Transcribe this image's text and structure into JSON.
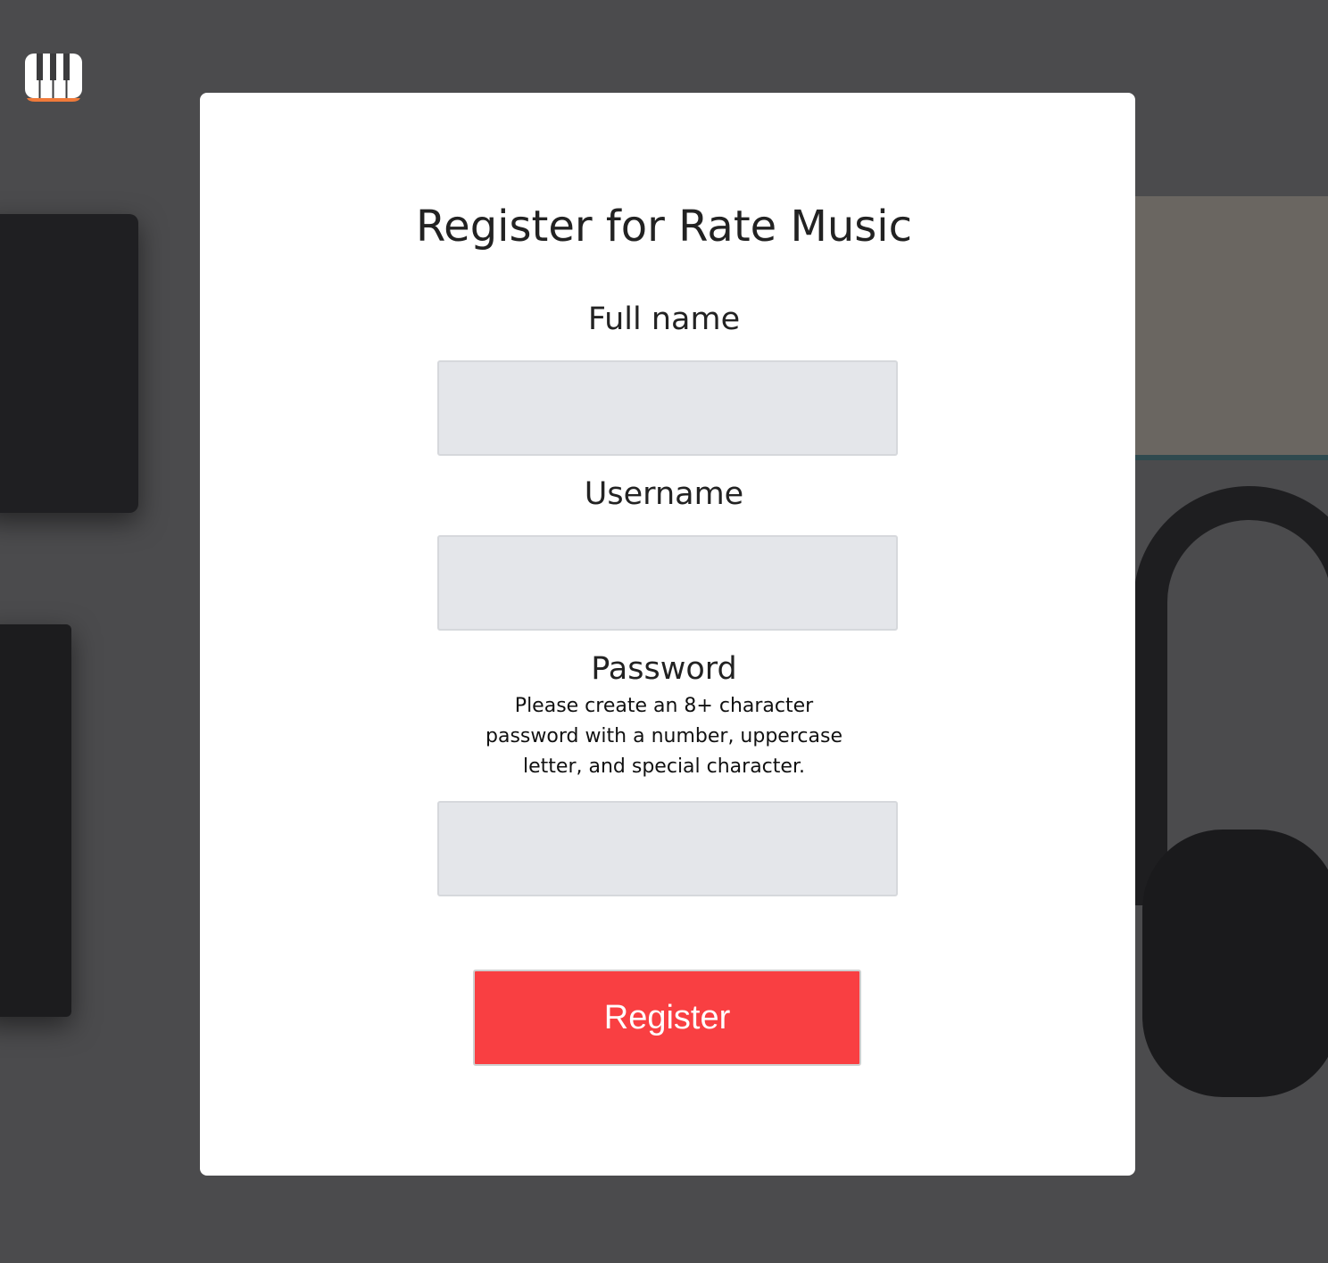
{
  "logo": {
    "icon": "piano-keys-icon",
    "accent": "#f07a3a"
  },
  "form": {
    "title": "Register for Rate Music",
    "fields": [
      {
        "label": "Full name",
        "value": "",
        "placeholder": ""
      },
      {
        "label": "Username",
        "value": "",
        "placeholder": ""
      },
      {
        "label": "Password",
        "value": "",
        "placeholder": "",
        "hint_lines": [
          "Please create an 8+ character",
          "password with a number, uppercase",
          "letter, and special character."
        ]
      }
    ],
    "submit_label": "Register",
    "submit_color": "#f93f42"
  }
}
